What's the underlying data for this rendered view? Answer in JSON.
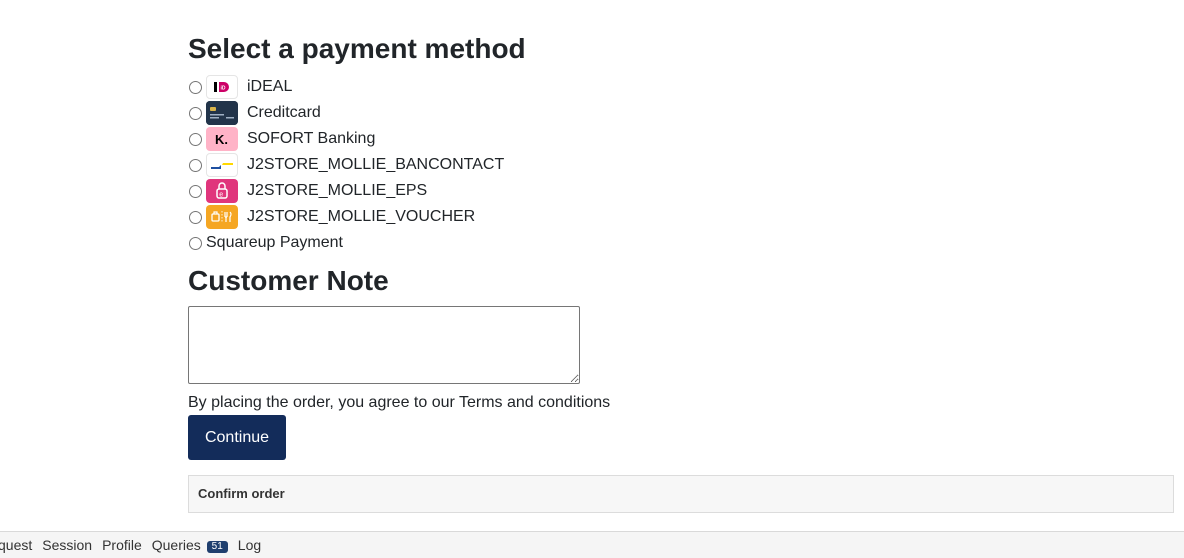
{
  "payment_section": {
    "title": "Select a payment method",
    "methods": [
      {
        "label": "iDEAL",
        "icon": "ideal-logo"
      },
      {
        "label": "Creditcard",
        "icon": "creditcard-logo"
      },
      {
        "label": "SOFORT Banking",
        "icon": "sofort-klarna-logo"
      },
      {
        "label": "J2STORE_MOLLIE_BANCONTACT",
        "icon": "bancontact-logo"
      },
      {
        "label": "J2STORE_MOLLIE_EPS",
        "icon": "eps-logo"
      },
      {
        "label": "J2STORE_MOLLIE_VOUCHER",
        "icon": "voucher-logo"
      },
      {
        "label": "Squareup Payment",
        "icon": ""
      }
    ]
  },
  "note_section": {
    "title": "Customer Note",
    "value": ""
  },
  "terms_text": "By placing the order, you agree to our Terms and conditions",
  "continue_label": "Continue",
  "confirm_label": "Confirm order",
  "debugbar": {
    "tabs": [
      "quest",
      "Session",
      "Profile",
      "Queries",
      "Log"
    ],
    "queries_count": "51"
  },
  "colors": {
    "primary_button": "#132c5a",
    "text": "#212529",
    "ideal": "#cc0066",
    "sofort": "#ffb3c7",
    "eps": "#e0357c",
    "voucher": "#f5a623"
  }
}
